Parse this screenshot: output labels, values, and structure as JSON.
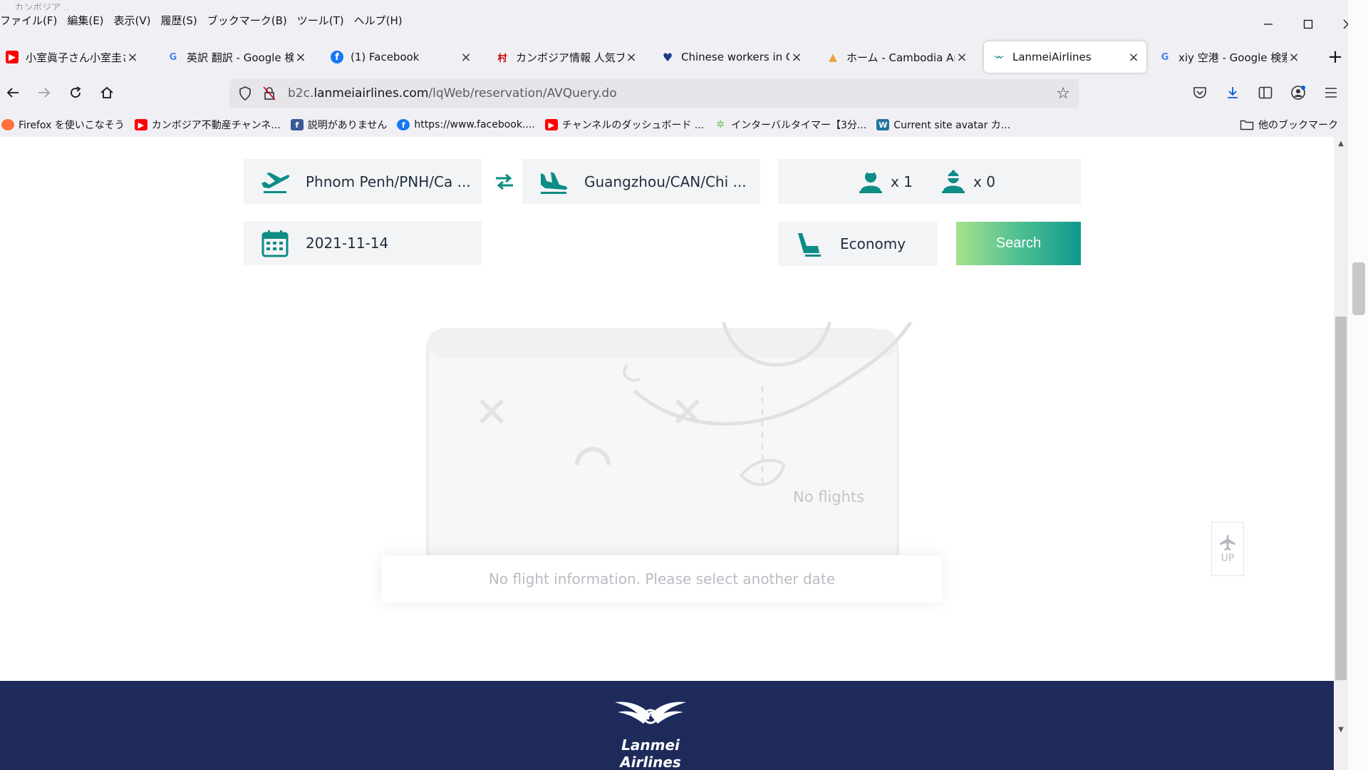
{
  "menubar": {
    "ghost_title": "カンボジア…",
    "items": [
      "ファイル(F)",
      "編集(E)",
      "表示(V)",
      "履歴(S)",
      "ブックマーク(B)",
      "ツール(T)",
      "ヘルプ(H)"
    ]
  },
  "tabs": [
    {
      "label": "小室眞子さん小室圭さん",
      "icon": "youtube-icon",
      "color": "#ff0000"
    },
    {
      "label": "英訳 翻訳 - Google 検索",
      "icon": "google-icon",
      "color": "#4285f4"
    },
    {
      "label": "(1) Facebook",
      "icon": "facebook-icon",
      "color": "#1877f2"
    },
    {
      "label": "カンボジア情報 人気ブログ",
      "icon": "blog-icon",
      "color": "#cc0000"
    },
    {
      "label": "Chinese workers in Cam",
      "icon": "heart-icon",
      "color": "#1b3a8a"
    },
    {
      "label": "ホーム - Cambodia Angko",
      "icon": "temple-icon",
      "color": "#e8a33d"
    },
    {
      "label": "LanmeiAirlines",
      "icon": "lanmei-icon",
      "color": "#0e8c86"
    },
    {
      "label": "xiy 空港 - Google 検索",
      "icon": "google-icon",
      "color": "#4285f4"
    }
  ],
  "url": {
    "prefix": "b2c.",
    "host": "lanmeiairlines.com",
    "path": "/lqWeb/reservation/AVQuery.do"
  },
  "bookmarks": [
    {
      "label": "Firefox を使いこなそう",
      "icon": "firefox-icon",
      "color": "#ff7139"
    },
    {
      "label": "カンボジア不動産チャンネ...",
      "icon": "youtube-icon",
      "color": "#ff0000"
    },
    {
      "label": "説明がありません",
      "icon": "facebook-icon",
      "color": "#3b5998"
    },
    {
      "label": "https://www.facebook....",
      "icon": "facebook-icon",
      "color": "#1877f2"
    },
    {
      "label": "チャンネルのダッシュボード ...",
      "icon": "youtube-icon",
      "color": "#ff0000"
    },
    {
      "label": "インターバルタイマー【3分...",
      "icon": "timer-icon",
      "color": "#6bbf59"
    },
    {
      "label": "Current site avatar カ...",
      "icon": "wordpress-icon",
      "color": "#21759b"
    }
  ],
  "other_bookmarks": "他のブックマーク",
  "search": {
    "origin": "Phnom Penh/PNH/Ca ...",
    "destination": "Guangzhou/CAN/Chi ...",
    "adults": "x 1",
    "children": "x 0",
    "date": "2021-11-14",
    "cabin": "Economy",
    "button": "Search"
  },
  "empty_state": {
    "illustration_label": "No flights",
    "message": "No flight information. Please select another date"
  },
  "up_button": "UP",
  "footer": {
    "brand": "Lanmei Airlines"
  },
  "colors": {
    "accent": "#0e8c86",
    "footer_bg": "#1e2a5a"
  }
}
